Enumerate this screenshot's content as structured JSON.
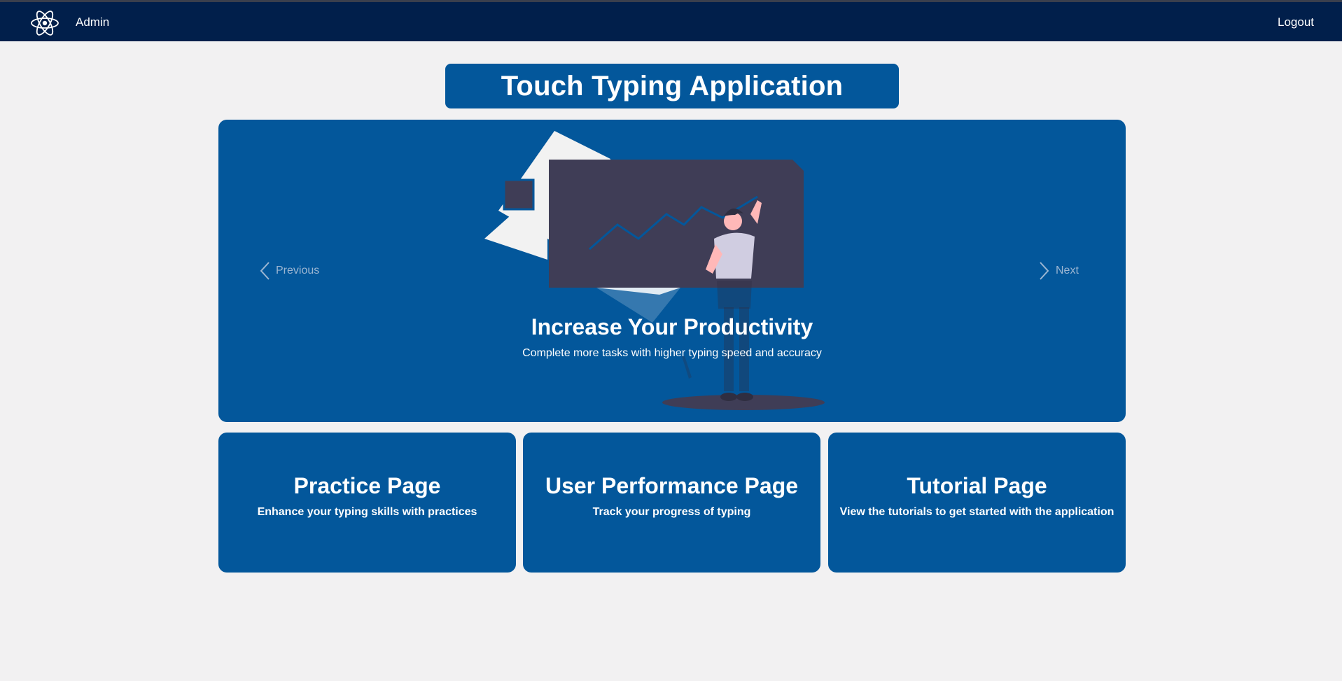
{
  "nav": {
    "brand": "Admin",
    "logout": "Logout",
    "logo_icon": "react-atom-icon"
  },
  "title": "Touch Typing Application",
  "carousel": {
    "prev_label": "Previous",
    "next_label": "Next",
    "slide_title": "Increase Your Productivity",
    "slide_text": "Complete more tasks with higher typing speed and accuracy",
    "illustration": "person-drawing-chart-on-board"
  },
  "cards": [
    {
      "title": "Practice Page",
      "text": "Enhance your typing skills with practices"
    },
    {
      "title": "User Performance Page",
      "text": "Track your progress of typing"
    },
    {
      "title": "Tutorial Page",
      "text": "View the tutorials to get started with the application"
    }
  ],
  "colors": {
    "navbar": "#011f4b",
    "primary": "#03579b",
    "background": "#f2f1f2",
    "board": "#3f3d56"
  }
}
